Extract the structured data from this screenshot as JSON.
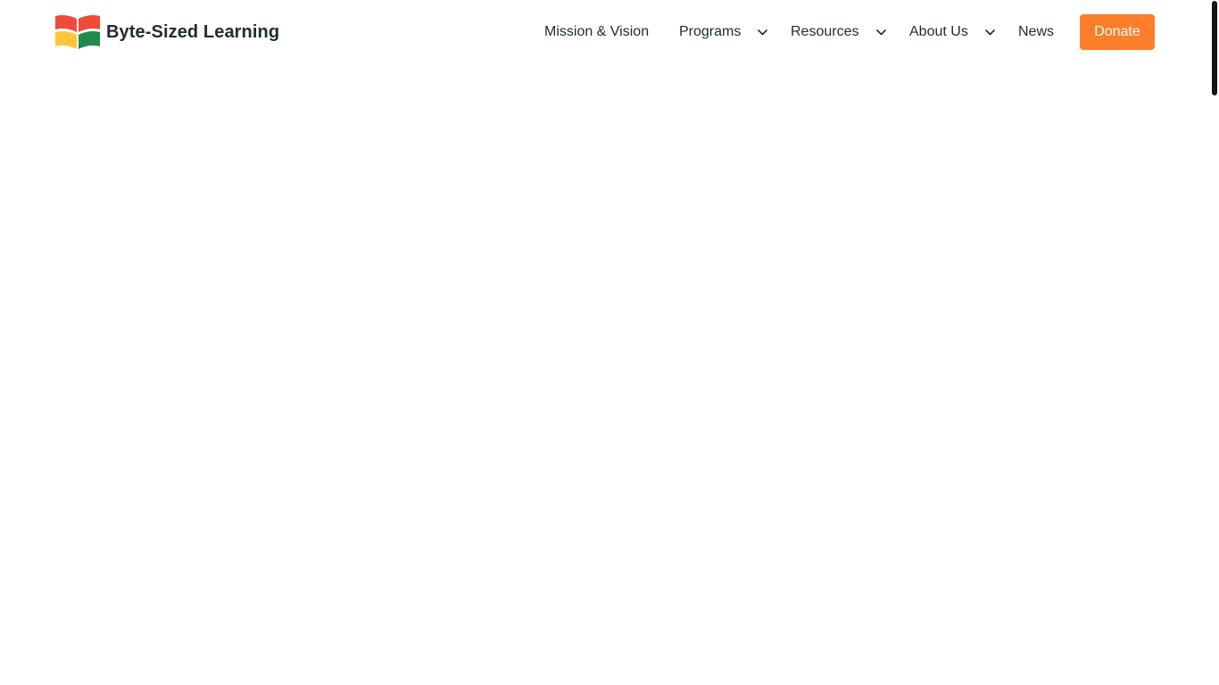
{
  "brand": {
    "name": "Byte-Sized Learning",
    "logo_icon": "open-book-logo",
    "logo_colors": [
      "#ef4a3a",
      "#ffc53d",
      "#1f8a4c"
    ]
  },
  "nav": {
    "items": [
      {
        "label": "Mission & Vision",
        "has_dropdown": false
      },
      {
        "label": "Programs",
        "has_dropdown": true,
        "icon": "chevron-down-icon"
      },
      {
        "label": "Resources",
        "has_dropdown": true,
        "icon": "chevron-down-icon"
      },
      {
        "label": "About Us",
        "has_dropdown": true,
        "icon": "chevron-down-icon"
      },
      {
        "label": "News",
        "has_dropdown": false
      }
    ],
    "cta": {
      "label": "Donate",
      "color": "#fd7e2a"
    }
  },
  "colors": {
    "text": "#222b36",
    "background": "#ffffff",
    "scrollbar_thumb": "#161616"
  }
}
